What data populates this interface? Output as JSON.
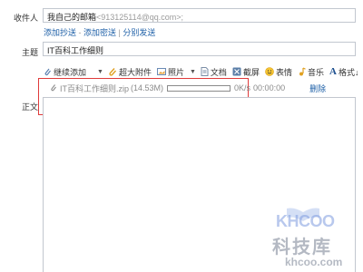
{
  "recipient": {
    "label": "收件人",
    "name": "我自己的邮箱",
    "address": "<913125114@qq.com>;"
  },
  "cc_links": {
    "add_cc": "添加抄送",
    "dash": " - ",
    "add_bcc": "添加密送",
    "bar": " | ",
    "separate_send": "分别发送"
  },
  "subject": {
    "label": "主题",
    "value": "IT百科工作细则"
  },
  "toolbar": {
    "continue_add": "继续添加",
    "large_attachment": "超大附件",
    "photo": "照片",
    "document": "文档",
    "screenshot": "截屏",
    "emoji": "表情",
    "music": "音乐",
    "format": "格式↓"
  },
  "attachment": {
    "filename": "IT百科工作细则.zip",
    "size": "(14.53M)",
    "rate": "0K/s",
    "eta": "00:00:00",
    "delete": "删除",
    "progress": 0
  },
  "body": {
    "label": "正文"
  },
  "watermark": {
    "logo": "KHCOO",
    "name": "科技库",
    "url": "khcoo.com"
  },
  "colors": {
    "highlight_border": "#e03a3a",
    "link": "#1d5fa7"
  }
}
